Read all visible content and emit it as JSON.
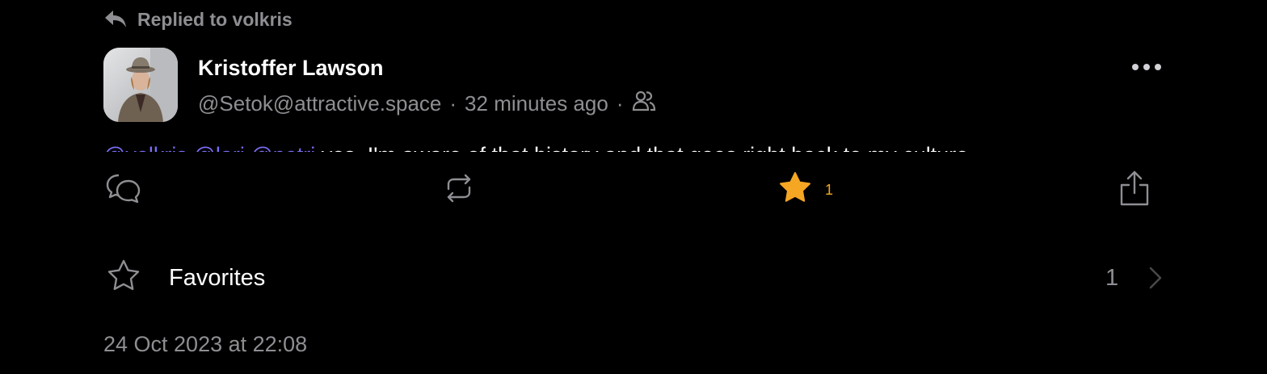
{
  "reply_context": {
    "icon": "reply-arrow-icon",
    "text": "Replied to volkris"
  },
  "post": {
    "author_name": "Kristoffer Lawson",
    "handle": "@Setok@attractive.space",
    "separator": "·",
    "time_ago": "32 minutes ago",
    "visibility_icon": "people-icon",
    "content_mentions": "@volkris @lari @petri",
    "content_text": " yes, I'm aware of that history and that goes right back to my culture"
  },
  "actions": {
    "reply_icon": "reply-bubbles-icon",
    "boost_icon": "boost-icon",
    "favorite_icon": "star-filled-icon",
    "favorite_count": "1",
    "share_icon": "share-icon"
  },
  "favorites": {
    "label": "Favorites",
    "count": "1"
  },
  "timestamp": "24 Oct 2023 at 22:08",
  "colors": {
    "background": "#000000",
    "secondary_text": "#8e8e93",
    "mention": "#7b6ef6",
    "favorite_accent": "#f5a623"
  }
}
